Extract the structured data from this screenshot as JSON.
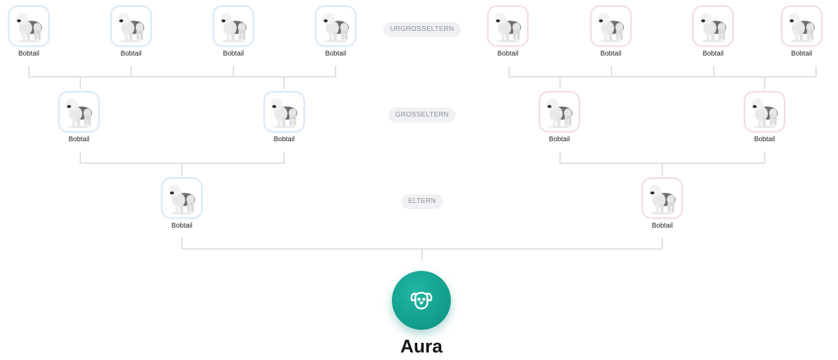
{
  "generations": {
    "great_grandparents_label": "URGROSSELTERN",
    "grandparents_label": "GROSSELTERN",
    "parents_label": "ELTERN"
  },
  "great_grandparents": [
    {
      "name": "Bobtail",
      "side": "sire"
    },
    {
      "name": "Bobtail",
      "side": "sire"
    },
    {
      "name": "Bobtail",
      "side": "sire"
    },
    {
      "name": "Bobtail",
      "side": "sire"
    },
    {
      "name": "Bobtail",
      "side": "dam"
    },
    {
      "name": "Bobtail",
      "side": "dam"
    },
    {
      "name": "Bobtail",
      "side": "dam"
    },
    {
      "name": "Bobtail",
      "side": "dam"
    }
  ],
  "grandparents": [
    {
      "name": "Bobtail",
      "side": "sire"
    },
    {
      "name": "Bobtail",
      "side": "sire"
    },
    {
      "name": "Bobtail",
      "side": "dam"
    },
    {
      "name": "Bobtail",
      "side": "dam"
    }
  ],
  "parents": [
    {
      "name": "Bobtail",
      "side": "sire"
    },
    {
      "name": "Bobtail",
      "side": "dam"
    }
  ],
  "subject": {
    "name": "Aura",
    "icon": "dog-face-icon",
    "accent": "#14a08f"
  },
  "colors": {
    "sire_border": "#dce9f6",
    "dam_border": "#f3dde2",
    "connector": "#d3d6db"
  }
}
